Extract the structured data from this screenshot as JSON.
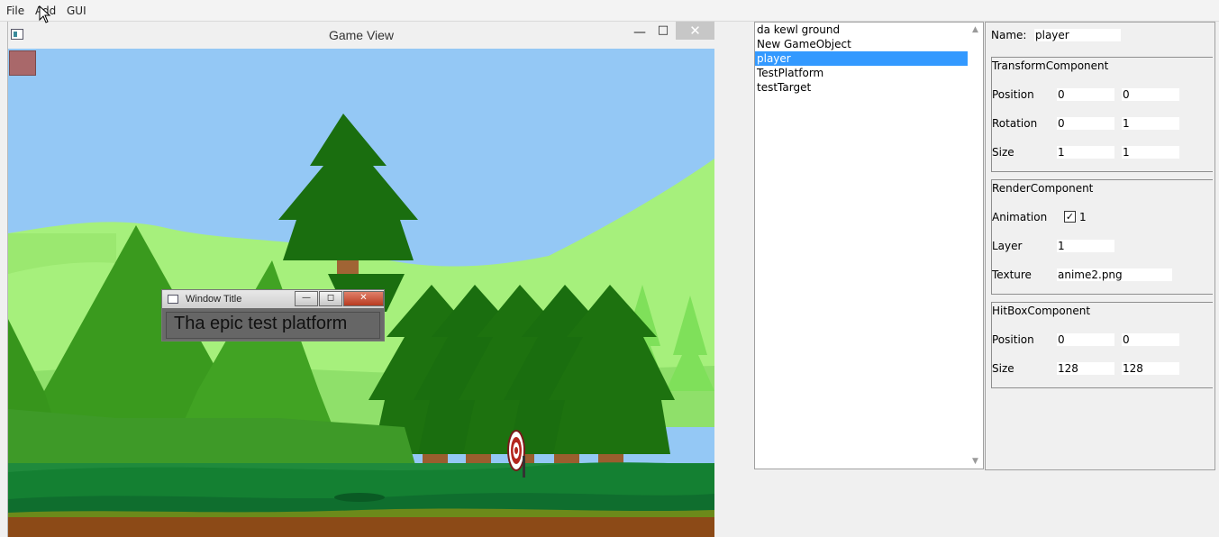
{
  "menu": {
    "items": [
      "File",
      "Add",
      "GUI"
    ]
  },
  "game_view": {
    "title": "Game View",
    "controls": {
      "minimize": "—",
      "maximize": "□",
      "close": "✕"
    },
    "ingame_window": {
      "title": "Window Title",
      "content": "Tha epic test platform",
      "controls": {
        "minimize": "—",
        "maximize": "◻",
        "close": "✕"
      }
    },
    "colors": {
      "sky": "#94c8f5",
      "hill_light": "#a6f07c",
      "ground_dark": "#0f6e2e",
      "dirt": "#8c4a17"
    }
  },
  "hierarchy": {
    "items": [
      "da kewl ground",
      "New GameObject",
      "player",
      "TestPlatform",
      "testTarget"
    ],
    "selected": "player",
    "scroll_up": "▲",
    "scroll_down": "▼"
  },
  "inspector": {
    "name_label": "Name:",
    "name_value": "player",
    "transform": {
      "title": "TransformComponent",
      "position_label": "Position",
      "position": [
        "0",
        "0"
      ],
      "rotation_label": "Rotation",
      "rotation": [
        "0",
        "1"
      ],
      "size_label": "Size",
      "size": [
        "1",
        "1"
      ]
    },
    "render": {
      "title": "RenderComponent",
      "animation_label": "Animation",
      "animation_checked": "✓",
      "animation_value": "1",
      "layer_label": "Layer",
      "layer": "1",
      "texture_label": "Texture",
      "texture": "anime2.png"
    },
    "hitbox": {
      "title": "HitBoxComponent",
      "position_label": "Position",
      "position": [
        "0",
        "0"
      ],
      "size_label": "Size",
      "size": [
        "128",
        "128"
      ]
    }
  }
}
